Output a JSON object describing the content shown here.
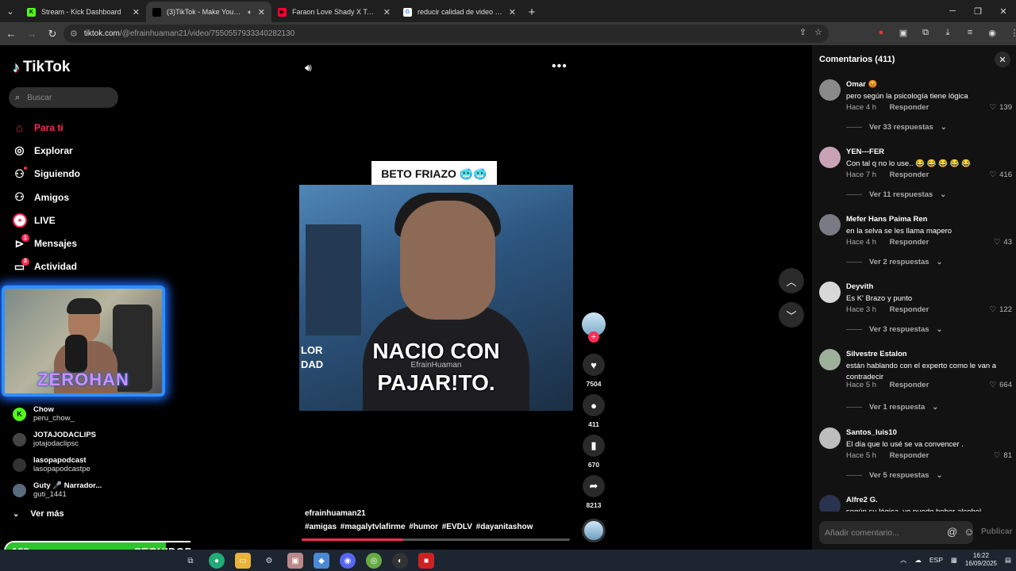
{
  "browser": {
    "tabs": [
      {
        "title": "Stream - Kick Dashboard",
        "fav_color": "#53fc18",
        "fav_glyph": "K",
        "active": false
      },
      {
        "title": "(3)TikTok - Make Your Day",
        "fav_color": "#000000",
        "fav_glyph": "♪",
        "active": true
      },
      {
        "title": "Faraon Love Shady X Tame Impala",
        "fav_color": "#ff0033",
        "fav_glyph": "▶",
        "active": false
      },
      {
        "title": "reducir calidad de video gratis",
        "fav_color": "#ffffff",
        "fav_glyph": "G",
        "active": false
      }
    ],
    "url_host": "tiktok.com",
    "url_path": "/@efrainhuaman21/video/7550557933340282130"
  },
  "sidebar": {
    "logo": "TikTok",
    "search_placeholder": "Buscar",
    "nav": [
      {
        "label": "Para ti",
        "icon": "home-icon",
        "active": true
      },
      {
        "label": "Explorar",
        "icon": "compass-icon"
      },
      {
        "label": "Siguiendo",
        "icon": "following-icon"
      },
      {
        "label": "Amigos",
        "icon": "friends-icon"
      },
      {
        "label": "LIVE",
        "icon": "live-icon"
      },
      {
        "label": "Mensajes",
        "icon": "messages-icon",
        "badge": "1"
      },
      {
        "label": "Actividad",
        "icon": "activity-icon",
        "badge": "2"
      }
    ],
    "following": [
      {
        "name": "Chow",
        "handle": "peru_chow_",
        "avatar_color": "#53fc18",
        "avatar_glyph": "K"
      },
      {
        "name": "JOTAJODACLIPS",
        "handle": "jotajodaclipsc",
        "avatar_color": "#444444",
        "avatar_glyph": ""
      },
      {
        "name": "lasopapodcast",
        "handle": "lasopapodcastpe",
        "avatar_color": "#333333",
        "avatar_glyph": ""
      },
      {
        "name": "Guty 🎤 Narrador...",
        "handle": "guti_1441",
        "avatar_color": "#5a6b7d",
        "avatar_glyph": ""
      }
    ],
    "see_more": "Ver más"
  },
  "webcam": {
    "brand": "ZEROHAN"
  },
  "follower_goal": {
    "current": "123",
    "label": "SEGUIDORES",
    "target": "250",
    "progress": 0.49
  },
  "video": {
    "title_card": "BETO FRIAZO 🥶🥶",
    "caption_line1": "NACIO CON",
    "caption_line2": "PAJAR!TO.",
    "watermark": "EfrainHuaman",
    "side_text_1": "LOR",
    "side_text_2": "DAD",
    "author": "efrainhuaman21",
    "tags": "#amigas #magalytvlafirme #humor #EVDLV #dayanitashow",
    "progress": 0.38,
    "likes": "7504",
    "comments": "411",
    "saves": "670",
    "shares": "8213"
  },
  "comments": {
    "header": "Comentarios (411)",
    "input_placeholder": "Añadir comentario...",
    "post_label": "Publicar",
    "reply_label": "Responder",
    "items": [
      {
        "name": "Omar 😡",
        "text": "pero según la psicología tiene lógica",
        "time": "Hace 4 h",
        "likes": "139",
        "replies": "Ver 33 respuestas",
        "avatar_color": "#8a8a8a"
      },
      {
        "name": "YEN---FER",
        "text": "Con tal q no lo use.. 😂 😂 😂 😂 😂",
        "time": "Hace 7 h",
        "likes": "416",
        "replies": "Ver 11 respuestas",
        "avatar_color": "#c9a3b5"
      },
      {
        "name": "Mefer Hans Paima Ren",
        "text": "en la selva se les llama mapero",
        "time": "Hace 4 h",
        "likes": "43",
        "replies": "Ver 2 respuestas",
        "avatar_color": "#7a7a85"
      },
      {
        "name": "Deyvith",
        "text": "Es K' Brazo y punto",
        "time": "Hace 3 h",
        "likes": "122",
        "replies": "Ver 3 respuestas",
        "avatar_color": "#d8d8d8"
      },
      {
        "name": "Silvestre Estalon",
        "text": "están hablando con el experto como le van a contradecir",
        "time": "Hace 5 h",
        "likes": "664",
        "replies": "Ver 1 respuesta",
        "avatar_color": "#9cb09a"
      },
      {
        "name": "Santos_luis10",
        "text": "El día que lo usé se va convencer .",
        "time": "Hace 5 h",
        "likes": "81",
        "replies": "Ver 5 respuestas",
        "avatar_color": "#bdbdbd"
      },
      {
        "name": "Alfre2 G.",
        "text": "según su lógica, yo puedo beber alcohol todo",
        "time": "",
        "likes": "",
        "replies": "",
        "avatar_color": "#2a3350"
      }
    ]
  },
  "taskbar": {
    "lang": "ESP",
    "time": "16:22",
    "date": "16/09/2025"
  }
}
